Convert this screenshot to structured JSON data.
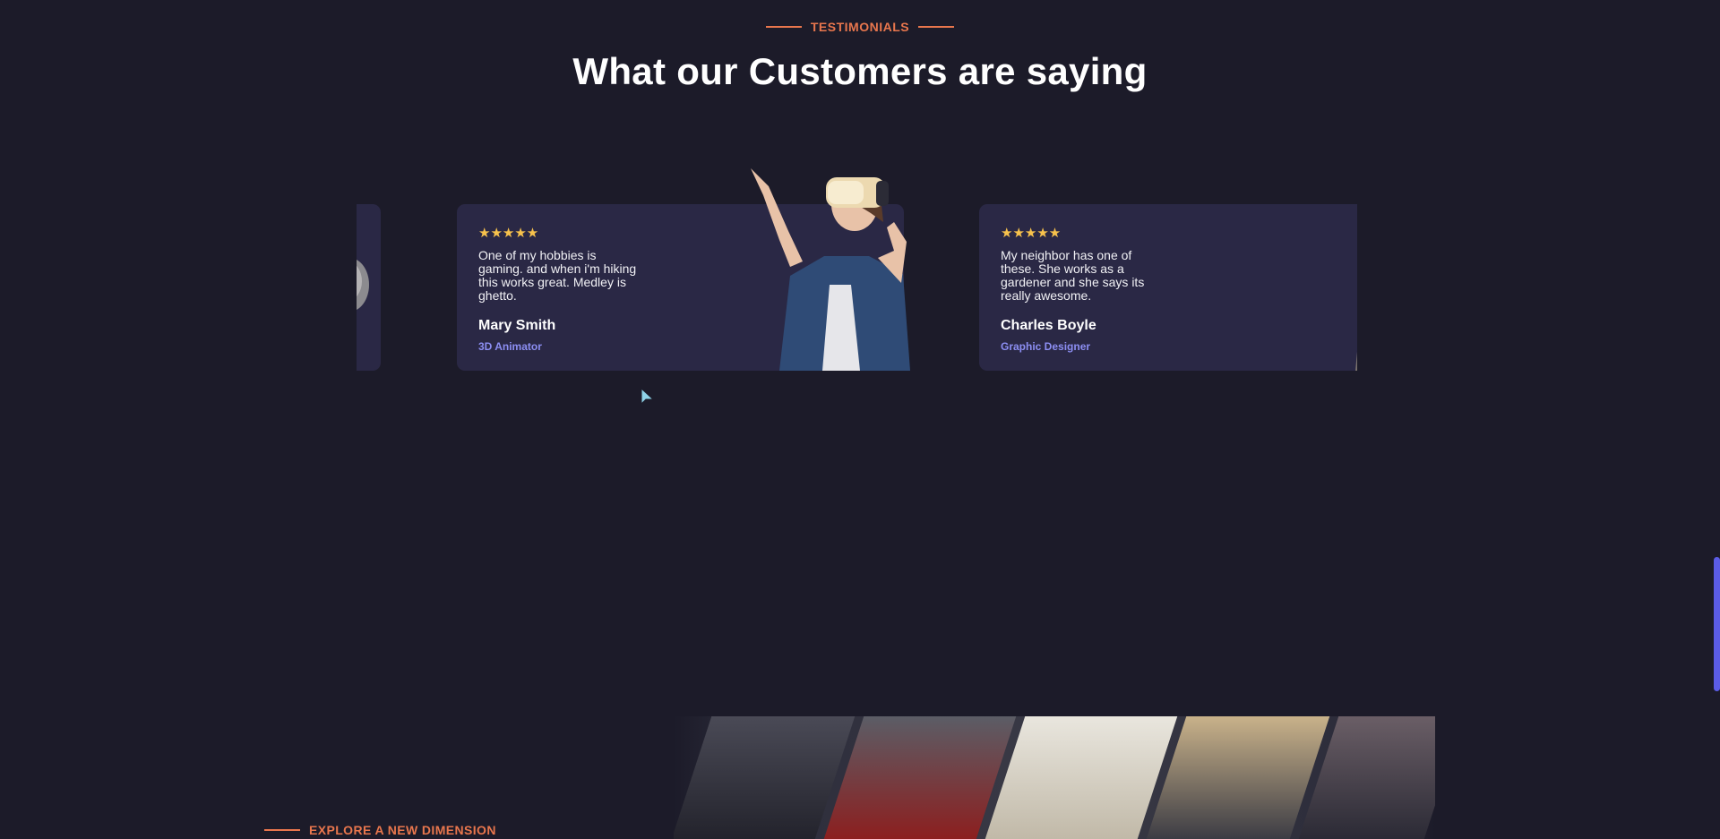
{
  "section": {
    "eyebrow": "TESTIMONIALS",
    "title": "What our Customers are saying"
  },
  "testimonials": [
    {
      "stars": "★★★★★",
      "quote": "One of my hobbies is gaming. and when i'm hiking this works great. Medley is ghetto.",
      "name": "Mary Smith",
      "role": "3D Animator"
    },
    {
      "stars": "★★★★★",
      "quote": "My neighbor has one of these. She works as a gardener and she says its really awesome.",
      "name": "Charles Boyle",
      "role": "Graphic Designer"
    }
  ],
  "explore": {
    "eyebrow": "EXPLORE A NEW DIMENSION"
  },
  "colors": {
    "background": "#1c1b29",
    "card": "#2a2845",
    "accent_orange": "#e8764d",
    "star": "#f7c24c",
    "role": "#8c8ef2",
    "scrollbar": "#5b5ce6"
  },
  "icons": [
    "star-icon",
    "cursor-icon"
  ]
}
